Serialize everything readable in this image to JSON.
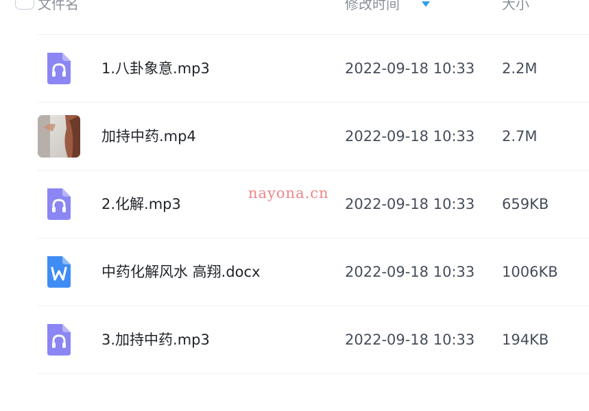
{
  "header": {
    "name_label": "文件名",
    "time_label": "修改时间",
    "size_label": "大小",
    "sort_icon": "sort-desc-triangle-icon",
    "accent_color": "#2b9cf2"
  },
  "files": [
    {
      "name": "1.八卦象意.mp3",
      "modified": "2022-09-18 10:33",
      "size": "2.2M",
      "icon": "audio-file-icon",
      "icon_color": "#8b86f3"
    },
    {
      "name": "加持中药.mp4",
      "modified": "2022-09-18 10:33",
      "size": "2.7M",
      "icon": "video-thumbnail",
      "icon_color": "#b89a86"
    },
    {
      "name": "2.化解.mp3",
      "modified": "2022-09-18 10:33",
      "size": "659KB",
      "icon": "audio-file-icon",
      "icon_color": "#8b86f3"
    },
    {
      "name": "中药化解风水 高翔.docx",
      "modified": "2022-09-18 10:33",
      "size": "1006KB",
      "icon": "word-file-icon",
      "icon_color": "#3f8cf5"
    },
    {
      "name": "3.加持中药.mp3",
      "modified": "2022-09-18 10:33",
      "size": "194KB",
      "icon": "audio-file-icon",
      "icon_color": "#8b86f3"
    }
  ],
  "watermark": "nayona.cn"
}
